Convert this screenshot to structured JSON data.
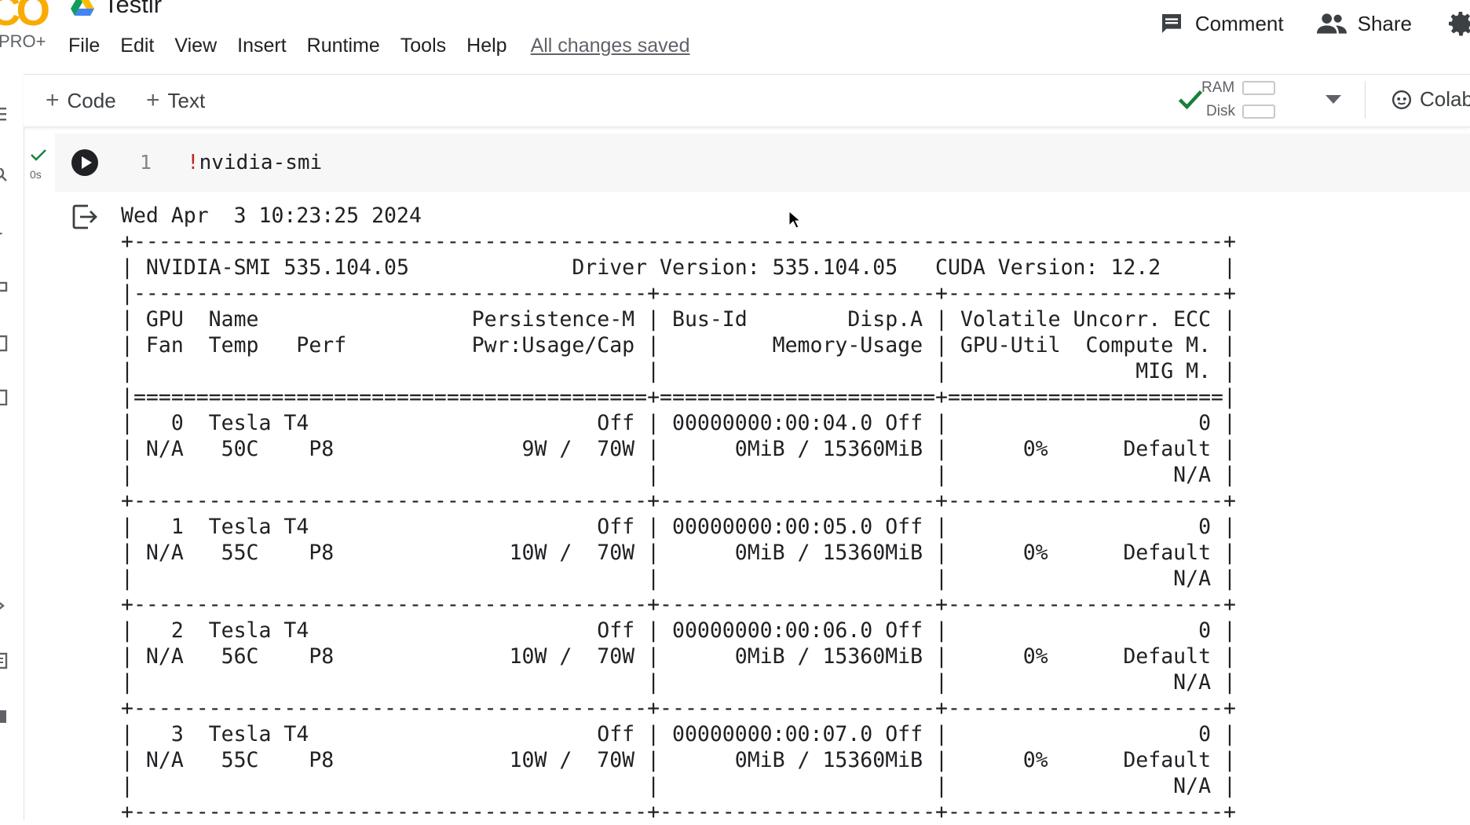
{
  "app": {
    "logo_text": "CO",
    "plan_badge": "PRO+",
    "title": "Testir"
  },
  "menu": [
    "File",
    "Edit",
    "View",
    "Insert",
    "Runtime",
    "Tools",
    "Help"
  ],
  "save_status": "All changes saved",
  "header_actions": {
    "comment_label": "Comment",
    "share_label": "Share"
  },
  "toolbar": {
    "add_code_label": "Code",
    "add_text_label": "Text",
    "ram_label": "RAM",
    "disk_label": "Disk",
    "colab_ai_label": "Colab AI",
    "accent_color": "#188038"
  },
  "cell": {
    "exec_time": "0s",
    "line_number": "1",
    "code_prefix": "!",
    "code_body": "nvidia-smi"
  },
  "output": {
    "text": "Wed Apr  3 10:23:25 2024\n+---------------------------------------------------------------------------------------+\n| NVIDIA-SMI 535.104.05             Driver Version: 535.104.05   CUDA Version: 12.2     |\n|-----------------------------------------+----------------------+----------------------+\n| GPU  Name                 Persistence-M | Bus-Id        Disp.A | Volatile Uncorr. ECC |\n| Fan  Temp   Perf          Pwr:Usage/Cap |         Memory-Usage | GPU-Util  Compute M. |\n|                                         |                      |               MIG M. |\n|=========================================+======================+======================|\n|   0  Tesla T4                       Off | 00000000:00:04.0 Off |                    0 |\n| N/A   50C    P8               9W /  70W |      0MiB / 15360MiB |      0%      Default |\n|                                         |                      |                  N/A |\n+-----------------------------------------+----------------------+----------------------+\n|   1  Tesla T4                       Off | 00000000:00:05.0 Off |                    0 |\n| N/A   55C    P8              10W /  70W |      0MiB / 15360MiB |      0%      Default |\n|                                         |                      |                  N/A |\n+-----------------------------------------+----------------------+----------------------+\n|   2  Tesla T4                       Off | 00000000:00:06.0 Off |                    0 |\n| N/A   56C    P8              10W /  70W |      0MiB / 15360MiB |      0%      Default |\n|                                         |                      |                  N/A |\n+-----------------------------------------+----------------------+----------------------+\n|   3  Tesla T4                       Off | 00000000:00:07.0 Off |                    0 |\n| N/A   55C    P8              10W /  70W |      0MiB / 15360MiB |      0%      Default |\n|                                         |                      |                  N/A |\n+-----------------------------------------+----------------------+----------------------+"
  }
}
